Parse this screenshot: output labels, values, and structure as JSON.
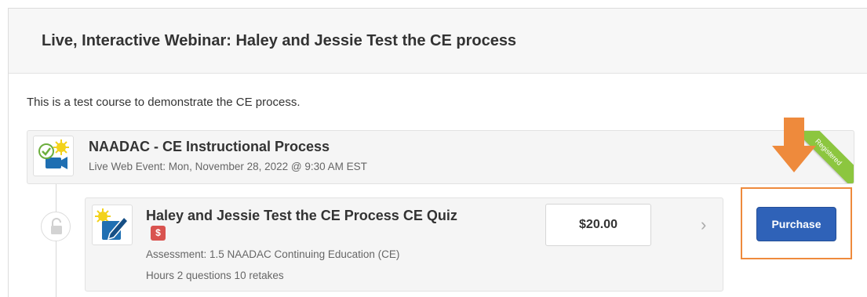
{
  "course": {
    "title": "Live, Interactive Webinar: Haley and Jessie Test the CE process",
    "description": "This is a test course to demonstrate the CE process."
  },
  "parent_item": {
    "title": "NAADAC - CE Instructional Process",
    "subtitle": "Live Web Event:  Mon, November 28, 2022 @ 9:30 AM EST",
    "ribbon": "Registered",
    "icon": "video-camera-completed-icon"
  },
  "child_item": {
    "title": "Haley and Jessie Test the CE Process CE Quiz",
    "badge": "$",
    "subtitle": "Assessment: 1.5 NAADAC Continuing Education (CE)",
    "meta": "Hours  2 questions  10 retakes",
    "price": "$20.00",
    "icon": "edit-pencil-icon",
    "lock_icon": "unlock-icon"
  },
  "actions": {
    "purchase_label": "Purchase"
  },
  "colors": {
    "purchase_button": "#2f62b8",
    "highlight": "#ee8a3c",
    "ribbon": "#8cc63f",
    "badge": "#d9534f"
  }
}
